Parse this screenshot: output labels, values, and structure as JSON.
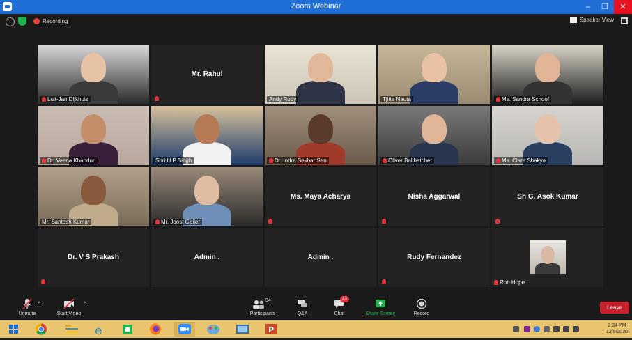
{
  "window": {
    "title": "Zoom Webinar",
    "min_glyph": "–",
    "max_glyph": "❐",
    "close_glyph": "✕"
  },
  "topbar": {
    "info_glyph": "i",
    "recording_label": "Recording",
    "speaker_view_label": "Speaker View"
  },
  "participants": [
    {
      "name": "Luit-Jan Dijkhuis",
      "muted": true,
      "video": true
    },
    {
      "name": "Mr. Rahul",
      "muted": true,
      "video": false
    },
    {
      "name": "Andy Roby",
      "muted": false,
      "video": true,
      "active_speaker": true
    },
    {
      "name": "Tjitte Nauta",
      "muted": false,
      "video": true
    },
    {
      "name": "Ms. Sandra Schoof",
      "muted": true,
      "video": true
    },
    {
      "name": "Dr. Veena Khanduri",
      "muted": true,
      "video": true
    },
    {
      "name": "Shri U P Singh",
      "muted": false,
      "video": true
    },
    {
      "name": "Dr. Indra Sekhar Sen",
      "muted": true,
      "video": true
    },
    {
      "name": "Oliver Ballhatchet",
      "muted": true,
      "video": true
    },
    {
      "name": "Ms. Clare Shakya",
      "muted": true,
      "video": true
    },
    {
      "name": "Mr. Santosh Kumar",
      "muted": false,
      "video": true
    },
    {
      "name": "Mr. Joost Geijer",
      "muted": true,
      "video": true
    },
    {
      "name": "Ms. Maya Acharya",
      "muted": true,
      "video": false
    },
    {
      "name": "Nisha Aggarwal",
      "muted": true,
      "video": false
    },
    {
      "name": "Sh G. Asok Kumar",
      "muted": true,
      "video": false
    },
    {
      "name": "Dr. V S Prakash",
      "muted": true,
      "video": false
    },
    {
      "name": "Admin .",
      "muted": false,
      "video": false
    },
    {
      "name": "Admin .",
      "muted": false,
      "video": false
    },
    {
      "name": "Rudy Fernandez",
      "muted": true,
      "video": false
    },
    {
      "name": "Rob Hope",
      "muted": true,
      "video": false,
      "avatar": true
    }
  ],
  "toolbar": {
    "unmute_label": "Unmute",
    "start_video_label": "Start Video",
    "participants_label": "Participants",
    "participants_count": "94",
    "qa_label": "Q&A",
    "chat_label": "Chat",
    "chat_badge": "13",
    "share_screen_label": "Share Screen",
    "record_label": "Record",
    "leave_label": "Leave",
    "caret": "^"
  },
  "taskbar": {
    "time": "2:34 PM",
    "date": "12/9/2020",
    "apps": [
      "start",
      "chrome",
      "file-explorer",
      "internet-explorer",
      "store",
      "firefox",
      "zoom",
      "paint",
      "pictures",
      "powerpoint"
    ]
  },
  "colors": {
    "accent": "#1f6fd6",
    "muted": "#e3323a",
    "share": "#23b14d",
    "leave": "#c7202a",
    "active": "#b6d53c"
  }
}
